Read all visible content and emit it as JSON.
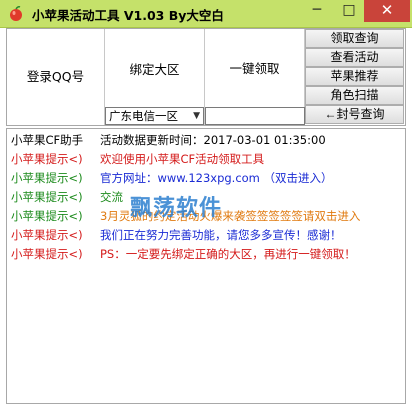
{
  "window": {
    "title": "小苹果活动工具 V1.03   By大空白",
    "minimize_glyph": "─",
    "maximize_glyph": "□",
    "close_glyph": "✕",
    "accent": "#c5e16a",
    "close_color": "#c9443a"
  },
  "panel": {
    "login_label": "登录QQ号",
    "area_label": "绑定大区",
    "claim_label": "一键领取",
    "area_select_value": "广东电信一区",
    "area_select_arrow": "▼",
    "buttons": [
      "领取查询",
      "查看活动",
      "苹果推荐",
      "角色扫描",
      "←封号查询"
    ]
  },
  "log": {
    "rows": [
      {
        "who": "小苹果CF助手",
        "msg": "活动数据更新时间：2017-03-01 01:35:00",
        "who_color": "c-black",
        "msg_color": "c-black"
      },
      {
        "who": "小苹果提示<)",
        "msg": "欢迎使用小苹果CF活动领取工具",
        "who_color": "c-red",
        "msg_color": "c-red"
      },
      {
        "who": "小苹果提示<)",
        "msg": "官方网址：www.123xpg.com （双击进入）",
        "who_color": "c-green",
        "msg_color": "c-blue"
      },
      {
        "who": "小苹果提示<)",
        "msg": "交流",
        "who_color": "c-green",
        "msg_color": "c-green"
      },
      {
        "who": "小苹果提示<)",
        "msg": "3月灵狐的约定活动火爆来袭签签签签签请双击进入",
        "who_color": "c-green",
        "msg_color": "c-orange"
      },
      {
        "who": "小苹果提示<)",
        "msg": "我们正在努力完善功能，请您多多宣传！感谢！",
        "who_color": "c-red",
        "msg_color": "c-blue"
      },
      {
        "who": "小苹果提示<)",
        "msg": "PS：一定要先绑定正确的大区，再进行一键领取！",
        "who_color": "c-red",
        "msg_color": "c-red"
      }
    ]
  },
  "watermark": "飘荡软件"
}
